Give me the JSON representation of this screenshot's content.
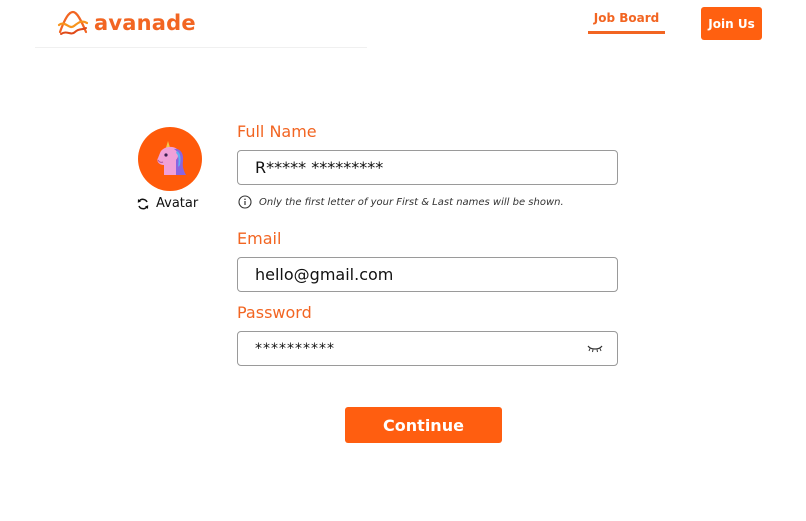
{
  "header": {
    "brand": "avanade",
    "nav": {
      "job_board": "Job Board"
    },
    "join_label": "Join Us"
  },
  "colors": {
    "accent": "#f26522",
    "button": "#ff5e10"
  },
  "avatar": {
    "label": "Avatar",
    "icon": "unicorn-icon",
    "refresh_icon": "refresh-icon"
  },
  "form": {
    "full_name": {
      "label": "Full Name",
      "value": "R***** *********"
    },
    "name_hint": "Only the first letter of your First & Last names will be shown.",
    "email": {
      "label": "Email",
      "value": "hello@gmail.com"
    },
    "password": {
      "label": "Password",
      "value": "**********"
    },
    "continue_label": "Continue"
  }
}
